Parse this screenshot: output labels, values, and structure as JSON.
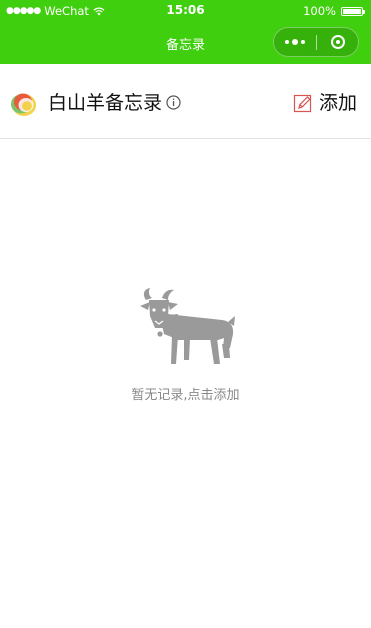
{
  "status_bar": {
    "carrier": "WeChat",
    "time": "15:06",
    "battery": "100%",
    "battery_level": 1.0
  },
  "nav": {
    "title": "备忘录"
  },
  "header": {
    "title": "白山羊备忘录",
    "add_label": "添加",
    "logo_icon": "rainbow-leaf-logo",
    "info_icon": "info-icon",
    "add_icon": "edit-pencil-icon"
  },
  "empty_state": {
    "icon": "goat-icon",
    "message": "暂无记录,点击添加"
  },
  "colors": {
    "accent": "#3fcf0e",
    "empty_icon": "#9a9a9a",
    "edit_icon": "#d9534f"
  }
}
